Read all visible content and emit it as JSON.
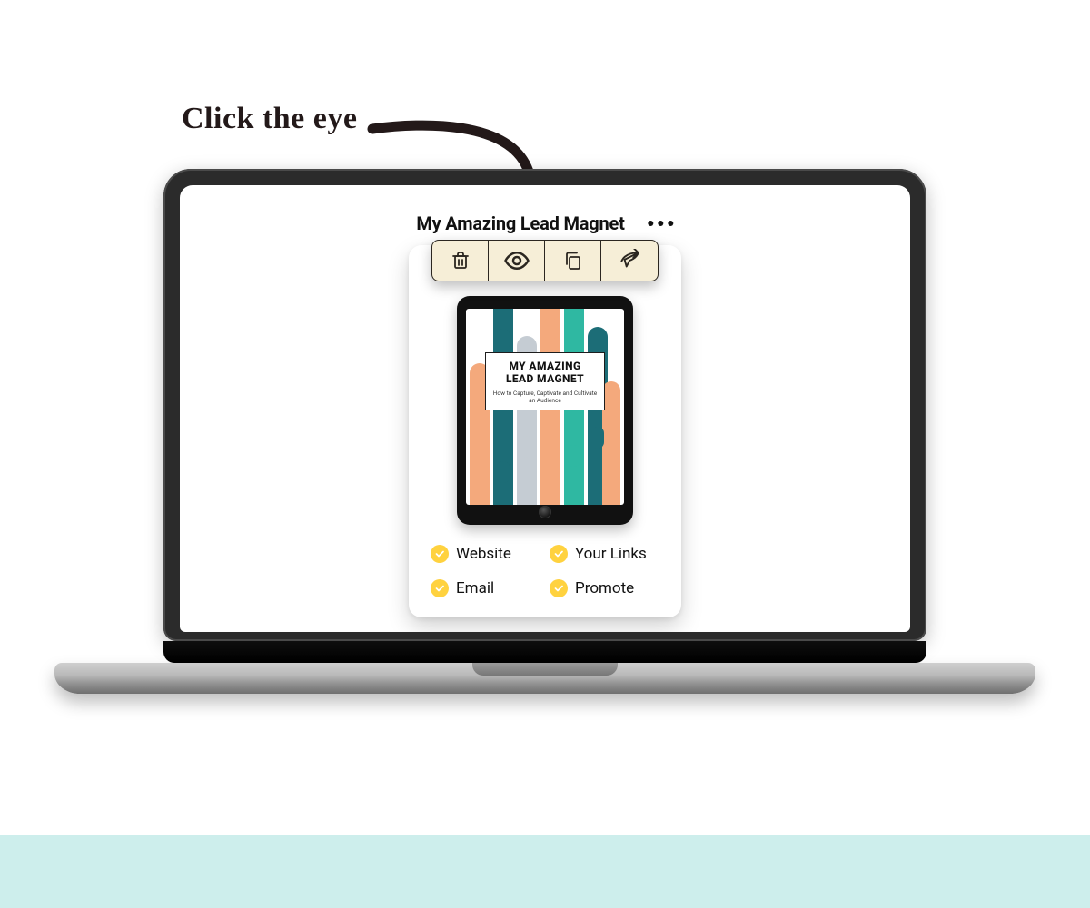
{
  "annotation": {
    "text": "Click the eye"
  },
  "document": {
    "title": "My Amazing Lead Magnet"
  },
  "toolbar": {
    "buttons": [
      "delete",
      "preview",
      "duplicate",
      "share"
    ]
  },
  "cover": {
    "title_line1": "MY AMAZING",
    "title_line2": "LEAD MAGNET",
    "subtitle": "How to Capture, Captivate and Cultivate an Audience"
  },
  "status": {
    "items": [
      {
        "label": "Website",
        "done": true
      },
      {
        "label": "Your Links",
        "done": true
      },
      {
        "label": "Email",
        "done": true
      },
      {
        "label": "Promote",
        "done": true
      }
    ]
  },
  "colors": {
    "accent_yellow": "#ffd23f",
    "toolbar_bg": "#f6eed7",
    "mint": "#cdeeec"
  }
}
